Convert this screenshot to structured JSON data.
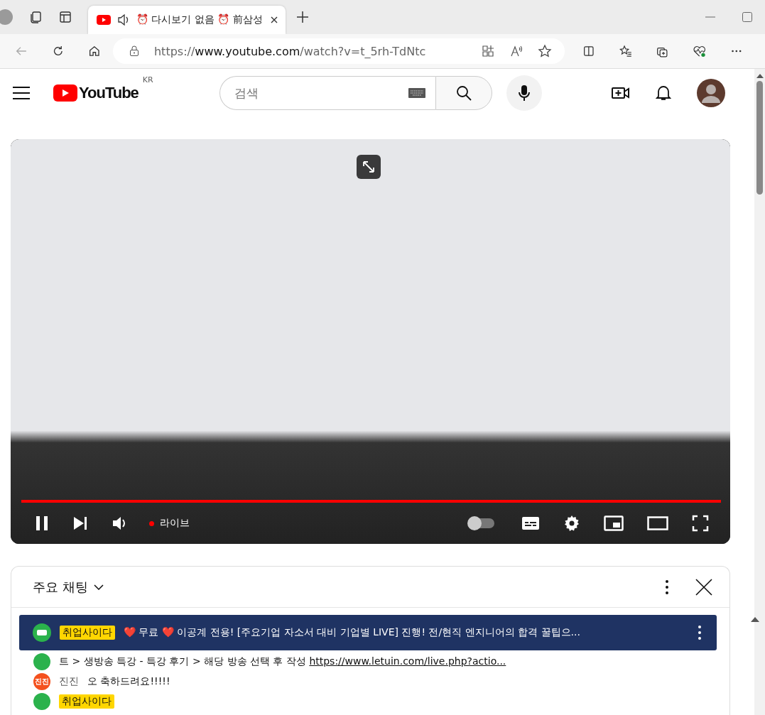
{
  "browser": {
    "tabs": [
      {
        "kind": "collections"
      },
      {
        "kind": "video",
        "title": "⏰ 다시보기 없음 ⏰ 前삼성",
        "audio": true,
        "selected": true
      }
    ],
    "address": {
      "scheme": "https://",
      "host": "www.youtube.com",
      "path": "/watch?v=t_5rh-TdNtc"
    }
  },
  "youtube": {
    "logo": "YouTube",
    "region": "KR",
    "search": {
      "placeholder": "검색"
    }
  },
  "player": {
    "playing": true,
    "live_label": "라이브",
    "progress": {
      "level": 1
    },
    "autoplay": false
  },
  "chat": {
    "title": "주요 채팅",
    "pinned": {
      "author": "취업사이다",
      "text": "❤️ 무료 ❤️ 이공계 전용! [주요기업 자소서 대비 기업별 LIVE] 진행! 전/현직 엔지니어의 합격 꿀팁으..."
    },
    "messages": [
      {
        "kind": "continued",
        "color": "#2bb24c",
        "text": "트 > 생방송 특강 - 특강 후기 > 해당 방송 선택 후 작성 ",
        "link": "https://www.letuin.com/live.php?actio..."
      },
      {
        "kind": "message",
        "color": "#f4511e",
        "avatar_label": "진진",
        "author": "진진",
        "owner": false,
        "text": "오 축하드려요!!!!!"
      },
      {
        "kind": "message",
        "color": "#2bb24c",
        "author": "취업사이다",
        "owner": true
      }
    ]
  }
}
